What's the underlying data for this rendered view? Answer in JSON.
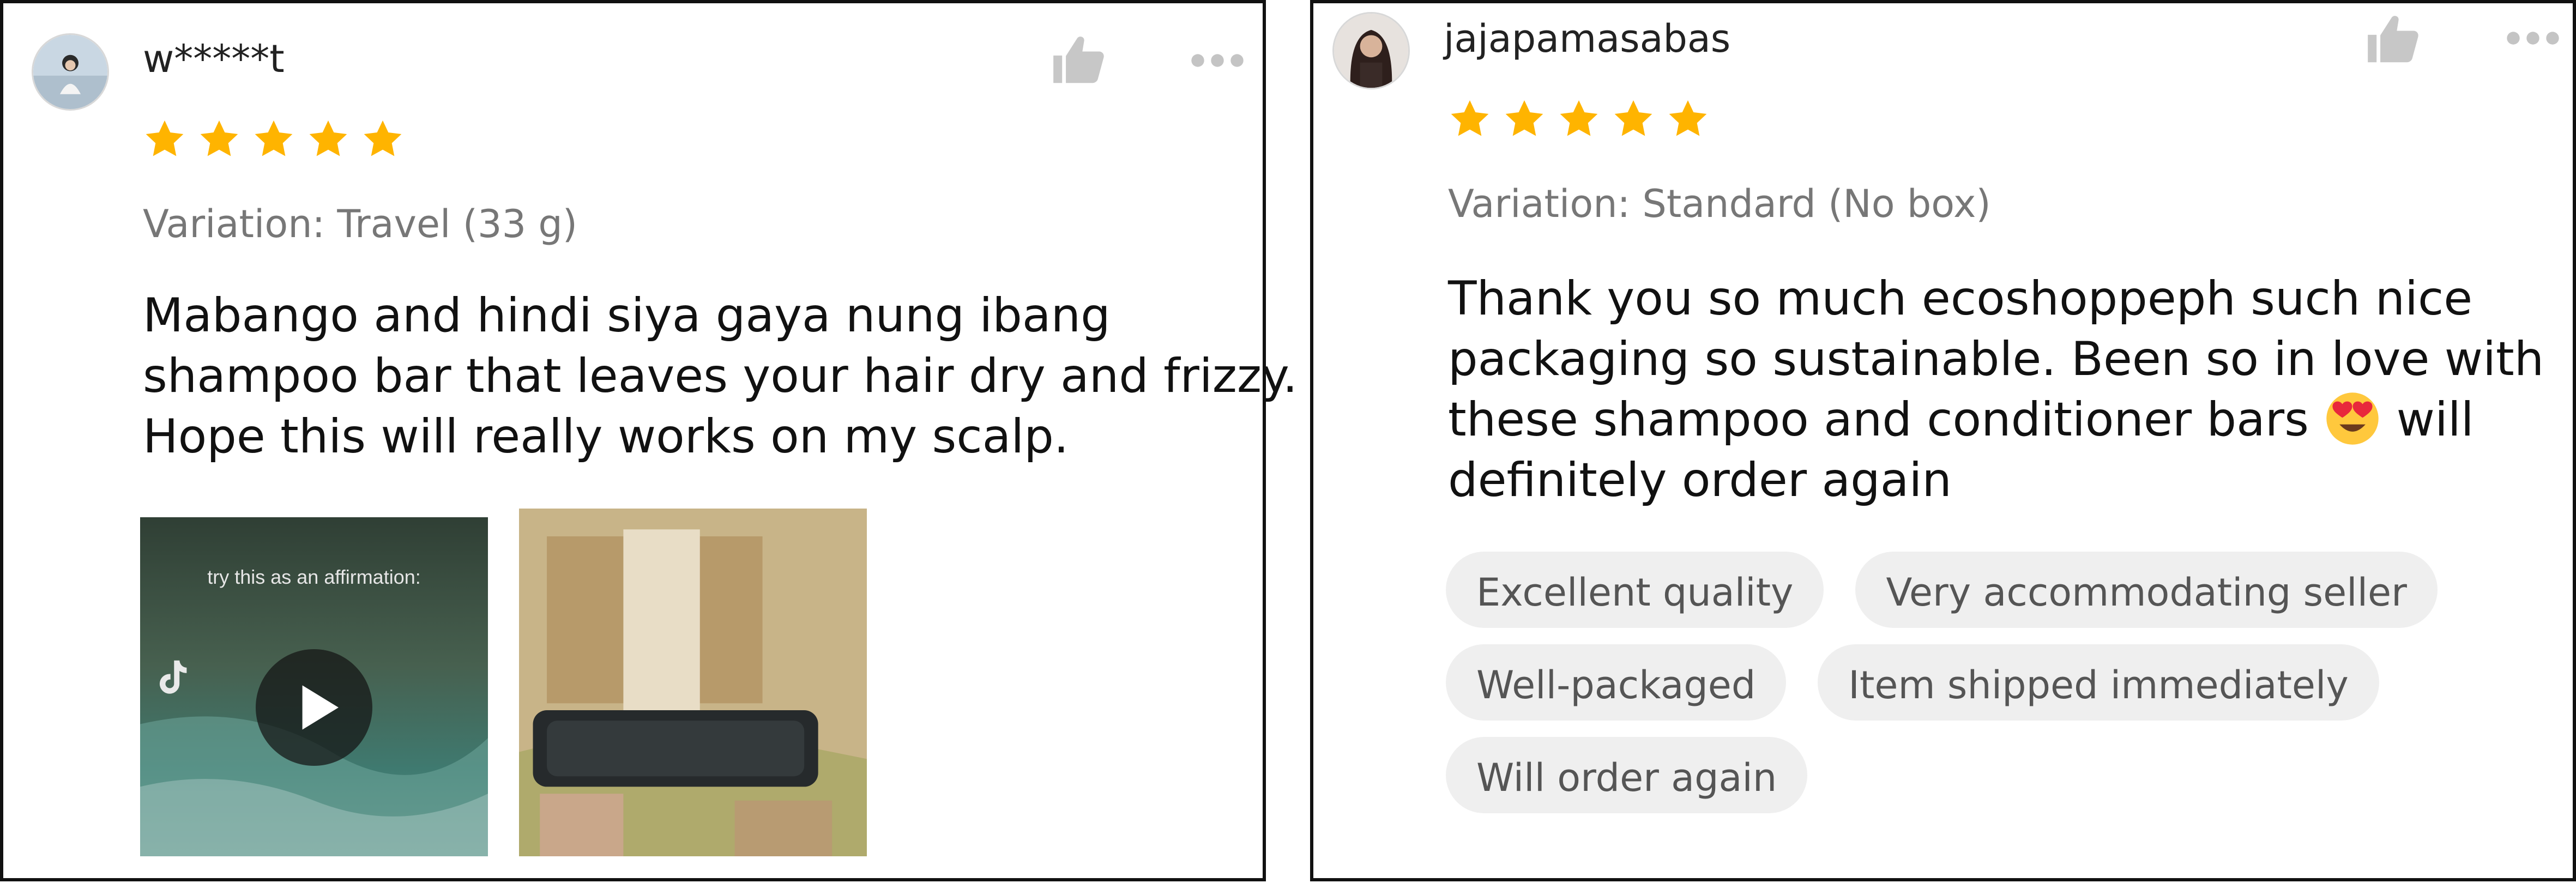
{
  "reviews": [
    {
      "username": "w*****t",
      "rating": 5,
      "variation": "Variation: Travel (33 g)",
      "text_lines": [
        "Mabango and hindi siya gaya nung ibang",
        "shampoo bar that leaves your hair dry and frizzy.",
        "Hope this will really works on my scalp."
      ],
      "media": {
        "video_caption": "try this as an affirmation:"
      }
    },
    {
      "username": "jajapamasabas",
      "rating": 5,
      "variation": "Variation: Standard (No box)",
      "text_lines": [
        "Thank you so much ecoshoppeph such nice",
        "packaging so sustainable. Been so in love with",
        "these shampoo and conditioner bars",
        "definitely order again"
      ],
      "text_line3_after_emoji": " will",
      "tags": [
        [
          "Excellent quality",
          "Very accommodating seller"
        ],
        [
          "Well-packaged",
          "Item shipped immediately"
        ],
        [
          "Will order again"
        ]
      ]
    }
  ],
  "colors": {
    "star": "#FFB400",
    "muted_icon": "#c7c7c7",
    "tag_bg": "#efefef"
  },
  "icons": [
    "thumbs-up-icon",
    "more-options-icon",
    "star-icon",
    "play-icon",
    "heart-eyes-emoji"
  ]
}
